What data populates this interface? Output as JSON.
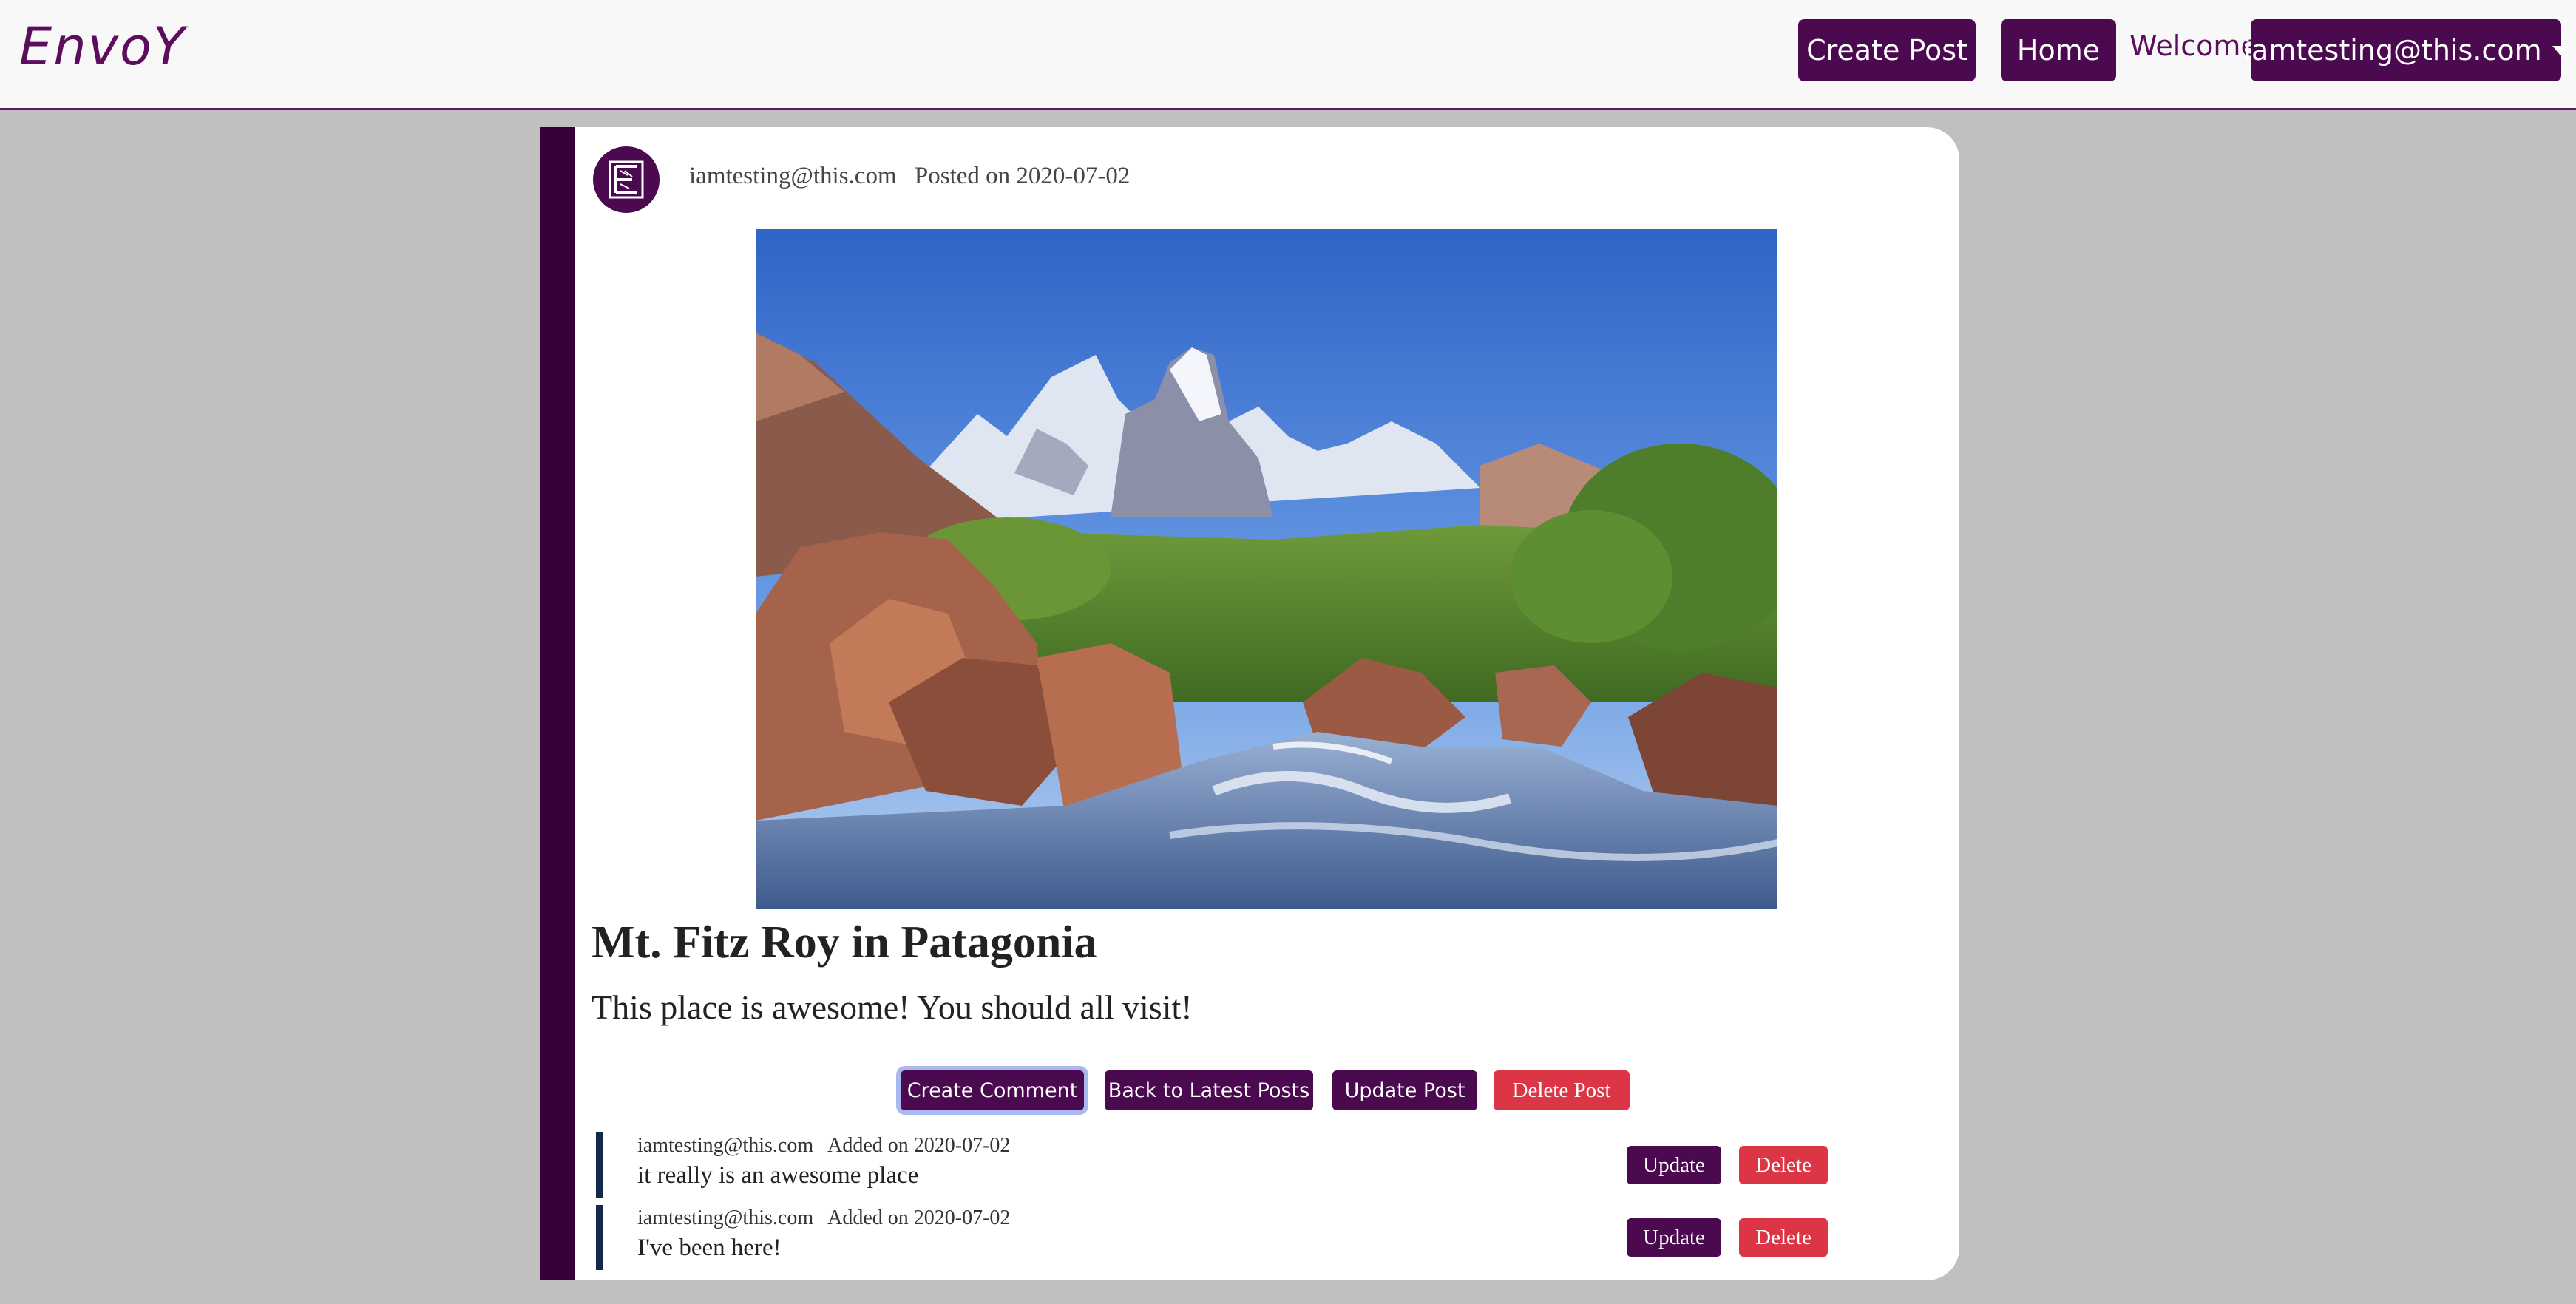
{
  "navbar": {
    "brand": "EnvoY",
    "create_post_label": "Create Post",
    "home_label": "Home",
    "welcome_text": "Welcome,",
    "user_menu_label": "iamtesting@this.com"
  },
  "post": {
    "author": "iamtesting@this.com",
    "posted_on": "Posted on 2020-07-02",
    "image_alt": "mountain landscape",
    "title": "Mt. Fitz Roy in Patagonia",
    "body": "This place is awesome! You should all visit!"
  },
  "actions": {
    "create_comment": "Create Comment",
    "back_to_latest": "Back to Latest Posts",
    "update_post": "Update Post",
    "delete_post": "Delete Post"
  },
  "comments": [
    {
      "author": "iamtesting@this.com",
      "added_on": "Added on 2020-07-02",
      "text": "it really is an awesome place",
      "update_label": "Update",
      "delete_label": "Delete"
    },
    {
      "author": "iamtesting@this.com",
      "added_on": "Added on 2020-07-02",
      "text": "I've been here!",
      "update_label": "Update",
      "delete_label": "Delete"
    }
  ],
  "colors": {
    "brand_purple": "#4b0a4f",
    "card_accent": "#37003b",
    "danger": "#dc3545",
    "comment_accent": "#13294b",
    "page_background": "#c0c0c0"
  }
}
